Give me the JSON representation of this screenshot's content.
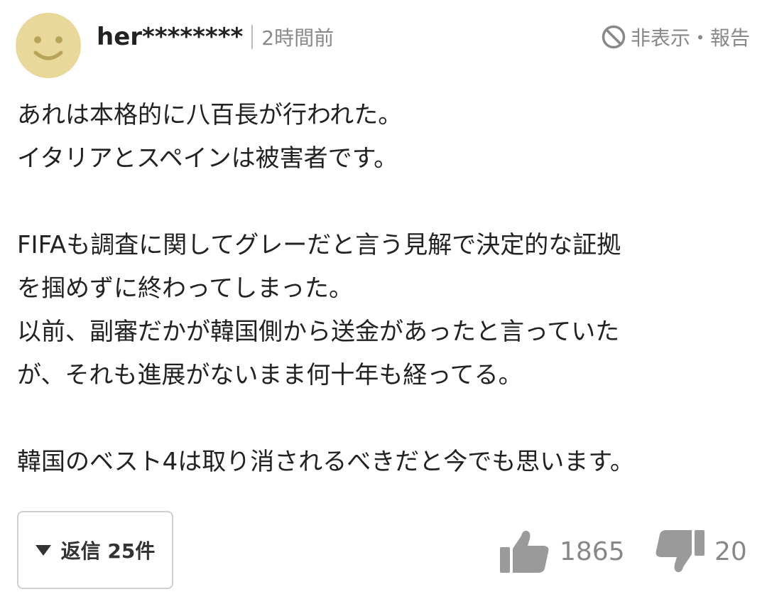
{
  "comment": {
    "username": "her********",
    "timestamp": "2時間前",
    "hide_report_label": "非表示・報告",
    "body_lines": [
      "あれは本格的に八百長が行われた。",
      "イタリアとスペインは被害者です。",
      "",
      "FIFAも調査に関してグレーだと言う見解で決定的な証拠",
      "を掴めずに終わってしまった。",
      "以前、副審だかが韓国側から送金があったと言っていた",
      "が、それも進展がないまま何十年も経ってる。",
      "",
      "韓国のベスト4は取り消されるべきだと今でも思います。"
    ],
    "reply_label": "返信 25件",
    "likes": "1865",
    "dislikes": "20"
  },
  "icons": {
    "avatar": "smiley-avatar-icon",
    "hide": "prohibited-icon",
    "reply_toggle": "triangle-down-icon",
    "like": "thumbs-up-icon",
    "dislike": "thumbs-down-icon"
  },
  "colors": {
    "avatar_fill": "#e8d99a",
    "avatar_face": "#b9a35a",
    "muted_text": "#888888",
    "body_text": "#222222",
    "thumb_icon": "#9a9a9a",
    "button_border": "#cfcfcf"
  }
}
